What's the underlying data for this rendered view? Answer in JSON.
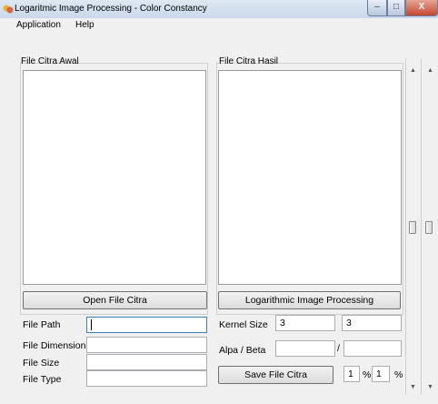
{
  "window": {
    "title": "Logaritmic Image Processing - Color Constancy",
    "minimize_glyph": "–",
    "maximize_glyph": "□",
    "close_glyph": "X"
  },
  "menu": {
    "items": [
      "Application",
      "Help"
    ]
  },
  "left_panel": {
    "label": "File Citra Awal",
    "open_button": "Open File Citra"
  },
  "right_panel": {
    "label": "File Citra Hasil",
    "process_button": "Logarithmic Image Processing",
    "save_button": "Save File Citra"
  },
  "file_info": {
    "path_label": "File Path",
    "path_value": "",
    "dimension_label": "File Dimension",
    "dimension_value": "",
    "size_label": "File Size",
    "size_value": "",
    "type_label": "File Type",
    "type_value": ""
  },
  "params": {
    "kernel_label": "Kernel Size",
    "kernel_w": "3",
    "kernel_h": "3",
    "alpha_beta_label": "Alpa / Beta",
    "alpha_value": "",
    "separator": "/",
    "beta_value": "",
    "save_pct_1": "1",
    "pct_symbol_1": "%",
    "save_pct_2": "1",
    "pct_symbol_2": "%"
  },
  "colors": {
    "titlebar": "#c9d8ea",
    "close_button": "#c4472f",
    "window_bg": "#f0f0f0",
    "focus_border": "#3c7fb1"
  }
}
